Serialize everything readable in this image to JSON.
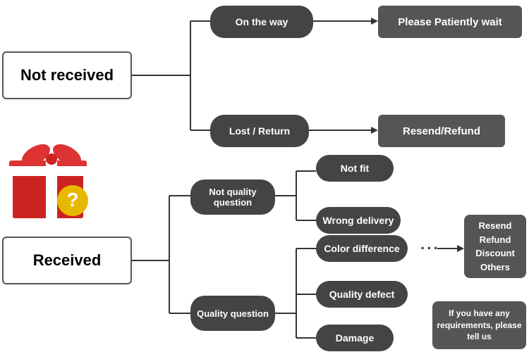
{
  "nodes": {
    "not_received": {
      "label": "Not received"
    },
    "on_the_way": {
      "label": "On the way"
    },
    "please_wait": {
      "label": "Please Patiently wait"
    },
    "lost_return": {
      "label": "Lost / Return"
    },
    "resend_refund_top": {
      "label": "Resend/Refund"
    },
    "received": {
      "label": "Received"
    },
    "not_quality_question": {
      "label": "Not quality question"
    },
    "quality_question": {
      "label": "Quality question"
    },
    "not_fit": {
      "label": "Not fit"
    },
    "wrong_delivery": {
      "label": "Wrong delivery"
    },
    "color_difference": {
      "label": "Color difference"
    },
    "quality_defect": {
      "label": "Quality defect"
    },
    "damage": {
      "label": "Damage"
    },
    "resend_refund_options": {
      "label": "Resend\nRefund\nDiscount\nOthers"
    },
    "if_requirements": {
      "label": "If you have any requirements, please tell us"
    }
  }
}
